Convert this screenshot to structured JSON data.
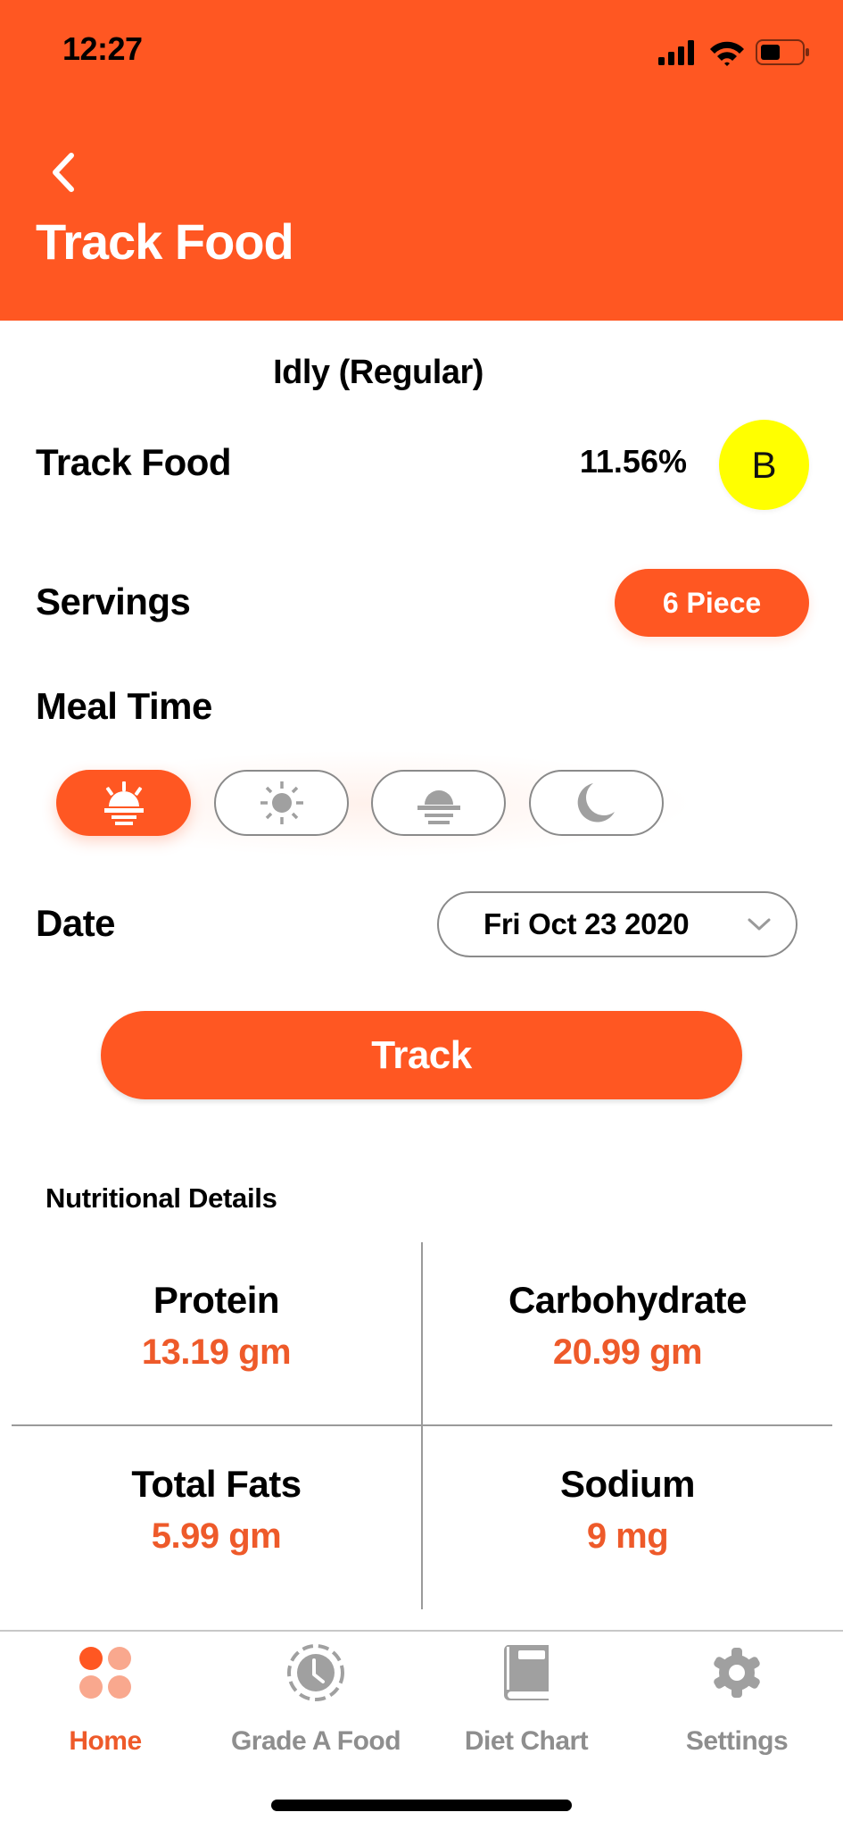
{
  "status_bar": {
    "time": "12:27",
    "icons": [
      "cellular-signal-icon",
      "wifi-icon",
      "battery-icon"
    ]
  },
  "header": {
    "back_icon": "chevron-left-icon",
    "title": "Track Food"
  },
  "food": {
    "name": "Idly (Regular)",
    "track_label": "Track Food",
    "percent": "11.56%",
    "grade": "B",
    "grade_color": "#FFFF00"
  },
  "servings": {
    "label": "Servings",
    "value": "6 Piece"
  },
  "meal_time": {
    "label": "Meal Time",
    "options": [
      {
        "name": "breakfast",
        "icon": "sunrise-icon",
        "selected": true
      },
      {
        "name": "lunch",
        "icon": "sun-icon",
        "selected": false
      },
      {
        "name": "snacks",
        "icon": "sunset-icon",
        "selected": false
      },
      {
        "name": "dinner",
        "icon": "moon-icon",
        "selected": false
      }
    ]
  },
  "date": {
    "label": "Date",
    "value": "Fri Oct 23 2020"
  },
  "track_button": {
    "label": "Track"
  },
  "nutrition": {
    "title": "Nutritional Details",
    "items": [
      {
        "label": "Protein",
        "value": "13.19 gm"
      },
      {
        "label": "Carbohydrate",
        "value": "20.99 gm"
      },
      {
        "label": "Total Fats",
        "value": "5.99 gm"
      },
      {
        "label": "Sodium",
        "value": "9 mg"
      }
    ]
  },
  "tabbar": {
    "items": [
      {
        "label": "Home",
        "icon": "grid-dots-icon",
        "active": true
      },
      {
        "label": "Grade A Food",
        "icon": "clock-icon",
        "active": false
      },
      {
        "label": "Diet Chart",
        "icon": "book-icon",
        "active": false
      },
      {
        "label": "Settings",
        "icon": "gear-icon",
        "active": false
      }
    ]
  },
  "colors": {
    "accent": "#FF5722",
    "value_text": "#EE5A2A",
    "inactive": "#8E8E8E",
    "icon_gray": "#A0A0A0"
  }
}
